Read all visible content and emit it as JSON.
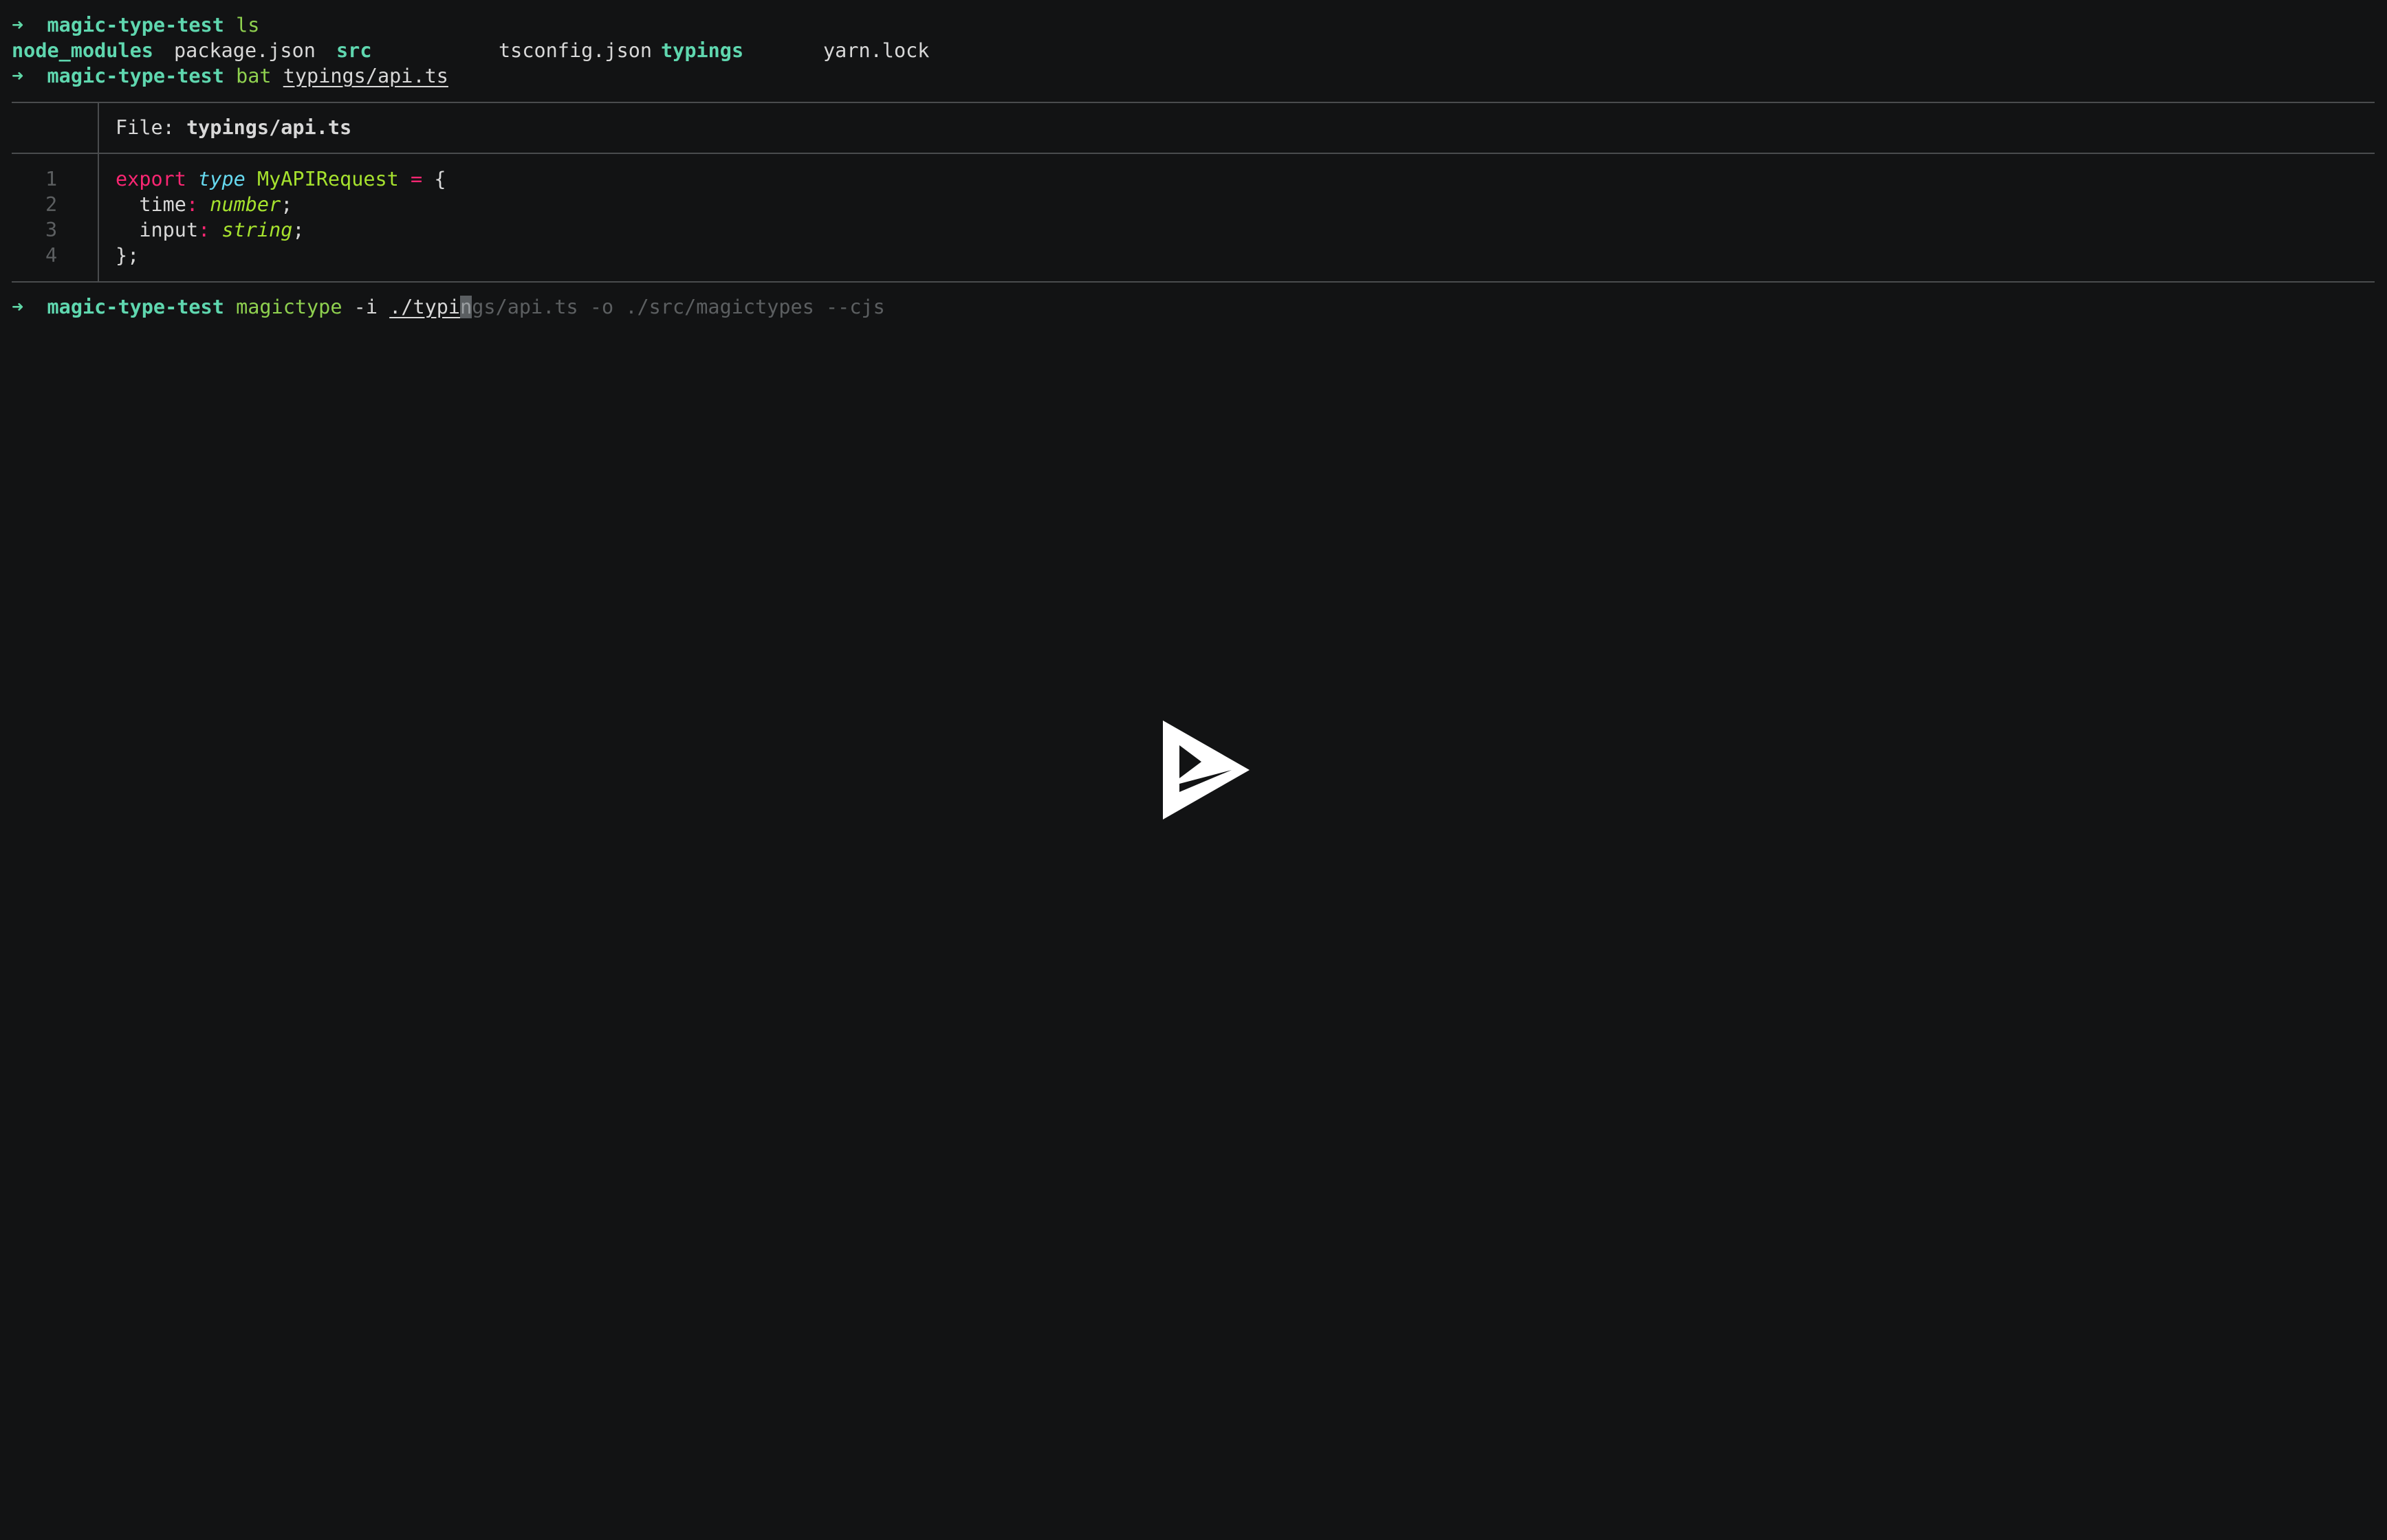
{
  "terminal": {
    "prompt_symbol": "➜",
    "prompt_dir": "magic-type-test",
    "line1": {
      "command": "ls"
    },
    "ls_output": {
      "items": [
        {
          "name": "node_modules",
          "kind": "dir"
        },
        {
          "name": "package.json",
          "kind": "file"
        },
        {
          "name": "src",
          "kind": "dir"
        },
        {
          "name": "tsconfig.json",
          "kind": "file"
        },
        {
          "name": "typings",
          "kind": "dir"
        },
        {
          "name": "yarn.lock",
          "kind": "file"
        }
      ]
    },
    "line3": {
      "command": "bat",
      "arg": "typings/api.ts"
    },
    "bat": {
      "file_label": "File:",
      "file_name": "typings/api.ts",
      "lines": [
        {
          "num": "1",
          "tokens": [
            "export",
            " ",
            "type",
            " ",
            "MyAPIRequest",
            " ",
            "=",
            " {"
          ]
        },
        {
          "num": "2",
          "tokens": [
            "  time",
            ":",
            " ",
            "number",
            ";"
          ]
        },
        {
          "num": "3",
          "tokens": [
            "  input",
            ":",
            " ",
            "string",
            ";"
          ]
        },
        {
          "num": "4",
          "tokens": [
            "};"
          ]
        }
      ]
    },
    "line_last": {
      "command": "magictype",
      "flag": " -i ",
      "typed_path": "./typi",
      "cursor_char": "n",
      "suggestion": "gs/api.ts -o ./src/magictypes --cjs"
    }
  },
  "player": {
    "icon": "asciinema-play-icon",
    "color": "#ffffff"
  }
}
